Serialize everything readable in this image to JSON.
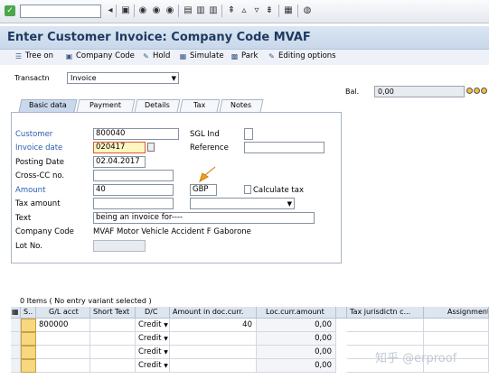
{
  "toolbar": {
    "command_field": ""
  },
  "page_title": "Enter Customer Invoice: Company Code MVAF",
  "app_toolbar": {
    "tree_on": "Tree on",
    "company_code": "Company Code",
    "hold": "Hold",
    "simulate": "Simulate",
    "park": "Park",
    "editing_options": "Editing options"
  },
  "transaction": {
    "label": "Transactn",
    "value": "Invoice"
  },
  "balance": {
    "label": "Bal.",
    "value": "0,00"
  },
  "tabs": [
    {
      "label": "Basic data",
      "active": true
    },
    {
      "label": "Payment"
    },
    {
      "label": "Details"
    },
    {
      "label": "Tax"
    },
    {
      "label": "Notes"
    }
  ],
  "form": {
    "customer_label": "Customer",
    "customer_value": "800040",
    "sgl_ind_label": "SGL Ind",
    "invoice_date_label": "Invoice date",
    "invoice_date_value": "020417",
    "reference_label": "Reference",
    "posting_date_label": "Posting Date",
    "posting_date_value": "02.04.2017",
    "cross_cc_label": "Cross-CC no.",
    "amount_label": "Amount",
    "amount_value": "40",
    "currency_value": "GBP",
    "calculate_tax_label": "Calculate tax",
    "tax_amount_label": "Tax amount",
    "text_label": "Text",
    "text_value": "being an invoice for----",
    "company_code_label": "Company Code",
    "company_code_value": "MVAF Motor Vehicle Accident F Gaborone",
    "lot_no_label": "Lot No."
  },
  "items": {
    "header": "0 Items ( No entry variant selected )",
    "columns": [
      "S..",
      "G/L acct",
      "Short Text",
      "D/C",
      "Amount in doc.curr.",
      "Loc.curr.amount",
      "Tax jurisdictn c...",
      "Assignment"
    ],
    "rows": [
      {
        "gl": "800000",
        "dc": "Credit",
        "amount": "40",
        "loc": "0,00"
      },
      {
        "gl": "",
        "dc": "Credit",
        "amount": "",
        "loc": "0,00"
      },
      {
        "gl": "",
        "dc": "Credit",
        "amount": "",
        "loc": "0,00"
      },
      {
        "gl": "",
        "dc": "Credit",
        "amount": "",
        "loc": "0,00"
      }
    ]
  },
  "watermark": "知乎 @erproof"
}
